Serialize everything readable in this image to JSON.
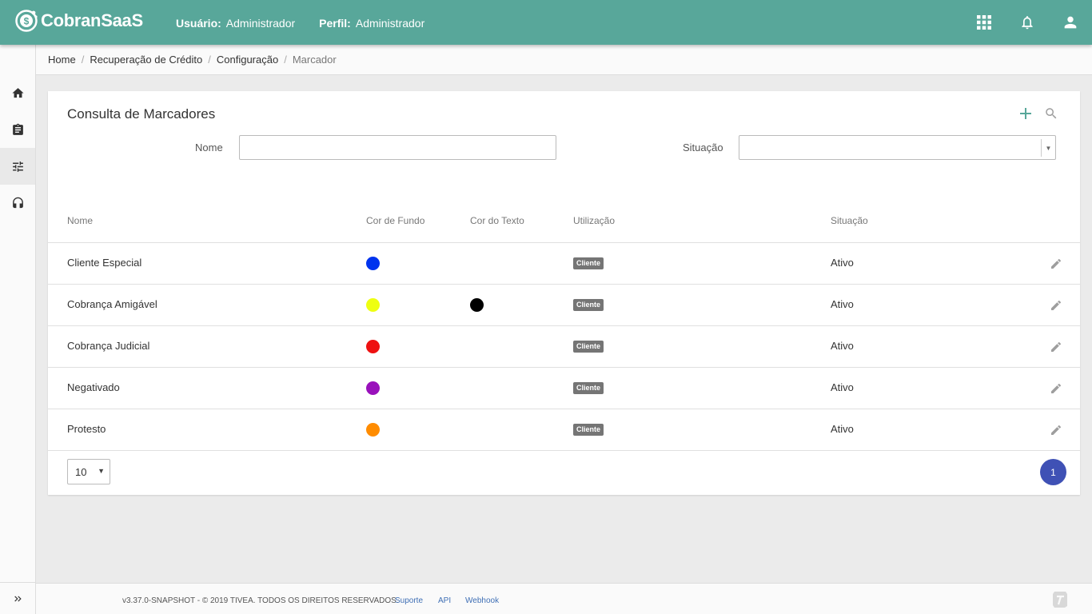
{
  "header": {
    "logo_text": "CobranSaaS",
    "user_label": "Usuário:",
    "user_value": "Administrador",
    "profile_label": "Perfil:",
    "profile_value": "Administrador",
    "icons": [
      "apps-grid-icon",
      "bell-icon",
      "account-icon"
    ]
  },
  "sidebar": {
    "items": [
      {
        "icon": "home-icon"
      },
      {
        "icon": "clipboard-icon"
      },
      {
        "icon": "sliders-icon",
        "active": true
      },
      {
        "icon": "headset-icon"
      }
    ],
    "expand_icon": "double-chevron-right-icon"
  },
  "breadcrumb": {
    "items": [
      "Home",
      "Recuperação de Crédito",
      "Configuração"
    ],
    "current": "Marcador",
    "separator": "/"
  },
  "search": {
    "title": "Consulta de Marcadores",
    "nome_label": "Nome",
    "nome_value": "",
    "situacao_label": "Situação",
    "situacao_value": ""
  },
  "table": {
    "columns": [
      "Nome",
      "Cor de Fundo",
      "Cor do Texto",
      "Utilização",
      "Situação"
    ],
    "rows": [
      {
        "nome": "Cliente Especial",
        "cor_fundo": "#0033ee",
        "cor_texto": null,
        "utilizacao": "Cliente",
        "situacao": "Ativo"
      },
      {
        "nome": "Cobrança Amigável",
        "cor_fundo": "#eeff11",
        "cor_texto": "#000000",
        "utilizacao": "Cliente",
        "situacao": "Ativo"
      },
      {
        "nome": "Cobrança Judicial",
        "cor_fundo": "#ee1111",
        "cor_texto": null,
        "utilizacao": "Cliente",
        "situacao": "Ativo"
      },
      {
        "nome": "Negativado",
        "cor_fundo": "#9911bb",
        "cor_texto": null,
        "utilizacao": "Cliente",
        "situacao": "Ativo"
      },
      {
        "nome": "Protesto",
        "cor_fundo": "#ff8c00",
        "cor_texto": null,
        "utilizacao": "Cliente",
        "situacao": "Ativo"
      }
    ]
  },
  "pagination": {
    "page_size": "10",
    "current_page": "1"
  },
  "footer": {
    "copyright": "v3.37.0-SNAPSHOT - © 2019 TIVEA. TODOS OS DIREITOS RESERVADOS.",
    "links": [
      "Suporte",
      "API",
      "Webhook"
    ]
  },
  "colors": {
    "primary": "#58a79a",
    "page_button": "#3f51b5",
    "chip": "#757575",
    "link": "#3f6fb5"
  }
}
